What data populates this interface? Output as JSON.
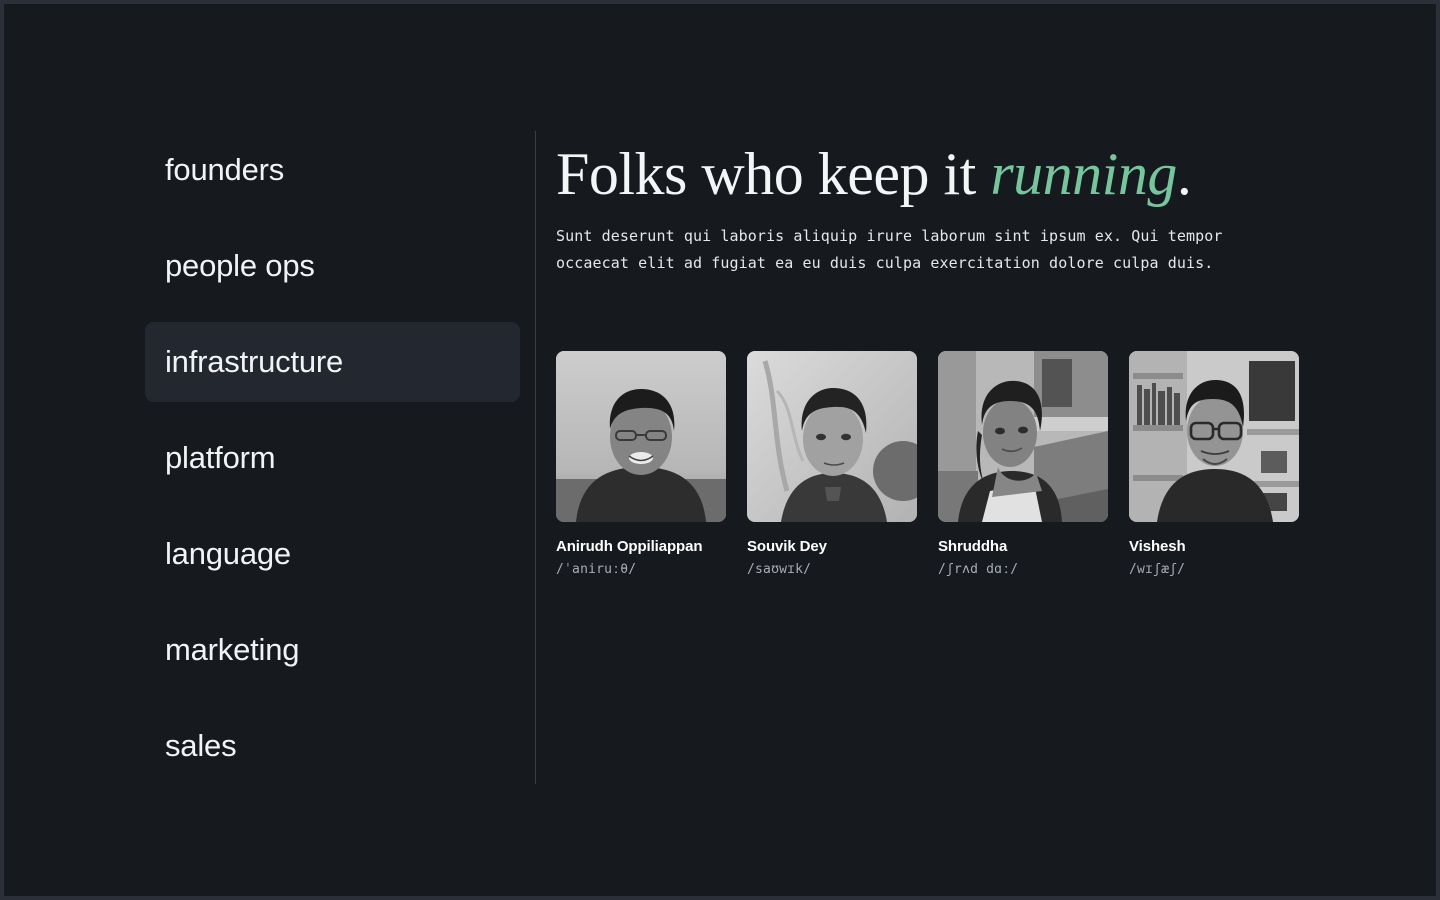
{
  "theme": {
    "page_background": "#16191e",
    "frame_background": "#2a2f38",
    "accent_green": "#74c79d",
    "active_item_background": "#23272f",
    "divider_color": "#3a3f48",
    "muted_text": "#a9adb4"
  },
  "sidebar": {
    "items": [
      {
        "label": "founders",
        "active": false
      },
      {
        "label": "people ops",
        "active": false
      },
      {
        "label": "infrastructure",
        "active": true
      },
      {
        "label": "platform",
        "active": false
      },
      {
        "label": "language",
        "active": false
      },
      {
        "label": "marketing",
        "active": false
      },
      {
        "label": "sales",
        "active": false
      }
    ]
  },
  "main": {
    "title_lead": "Folks who keep it ",
    "title_accent": "running",
    "title_period": ".",
    "subtitle": "Sunt deserunt qui laboris aliquip irure laborum sint ipsum ex. Qui tempor occaecat elit ad fugiat ea eu duis culpa exercitation dolore culpa duis.",
    "team": [
      {
        "name": "Anirudh Oppiliappan",
        "ipa": "/ˈaniruːθ/",
        "photo_alt": "portrait-anirudh"
      },
      {
        "name": "Souvik Dey",
        "ipa": "/saʊwɪk/",
        "photo_alt": "portrait-souvik"
      },
      {
        "name": "Shruddha",
        "ipa": "/ʃrʌd dɑː/",
        "photo_alt": "portrait-shruddha"
      },
      {
        "name": "Vishesh",
        "ipa": "/wɪʃæʃ/",
        "photo_alt": "portrait-vishesh"
      }
    ]
  }
}
